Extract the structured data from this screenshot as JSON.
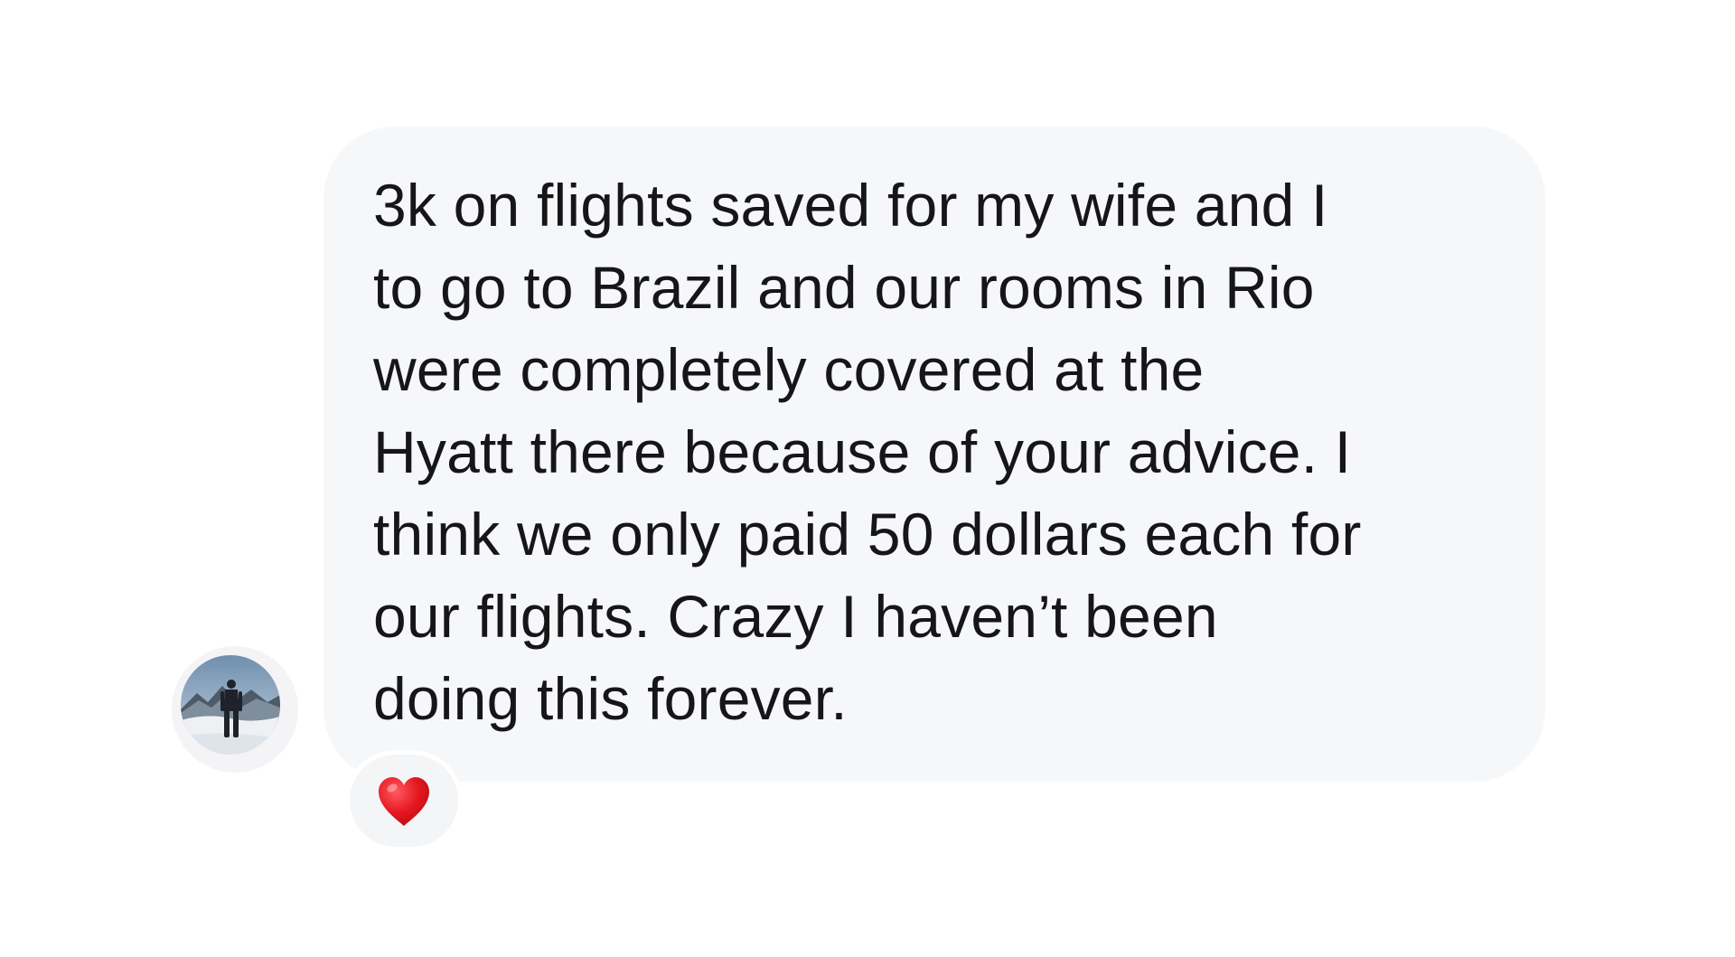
{
  "message": {
    "lines": [
      "3k on flights saved for my wife and I",
      "to go to Brazil and our rooms in Rio",
      "were completely covered at the",
      "Hyatt there because of your advice. I",
      "think we only paid 50 dollars each for",
      "our flights. Crazy I haven’t been",
      "doing this forever."
    ],
    "bubble_color": "#f6f7f9",
    "text_color": "#161618"
  },
  "sender": {
    "avatar_icon": "profile-photo-mountain-hiker"
  },
  "reaction": {
    "icon": "red-heart-icon",
    "color": "#e5171f"
  }
}
